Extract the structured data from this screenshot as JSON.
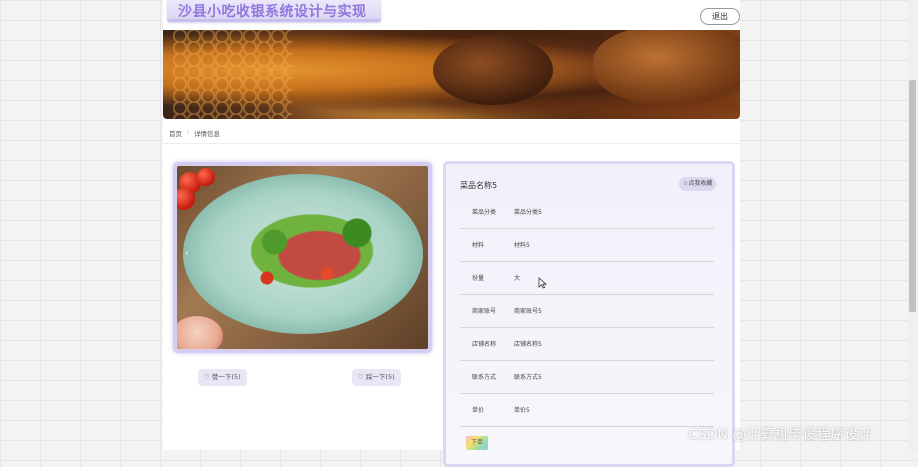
{
  "header": {
    "site_title": "沙县小吃收银系统设计与实现",
    "logout_label": "退出"
  },
  "breadcrumb": {
    "home": "首页",
    "separator": ":",
    "current": "详情信息"
  },
  "gallery": {
    "prev_glyph": "‹",
    "dots": 3,
    "active_dot": 0,
    "like_label": "赞一下(5)",
    "dislike_label": "踩一下(5)"
  },
  "detail": {
    "title": "菜品名称5",
    "favorite_label": "点我收藏",
    "rows": [
      {
        "label": "菜品分类",
        "value": "菜品分类5"
      },
      {
        "label": "材料",
        "value": "材料5"
      },
      {
        "label": "份量",
        "value": "大"
      },
      {
        "label": "商家账号",
        "value": "商家账号5"
      },
      {
        "label": "店铺名称",
        "value": "店铺名称5"
      },
      {
        "label": "联系方式",
        "value": "联系方式5"
      },
      {
        "label": "单价",
        "value": "单价5"
      }
    ],
    "tag_label": "下单"
  },
  "watermark": "CSDN @计算机毕设程序设计",
  "colors": {
    "accent": "#8f77dd",
    "card_border": "#dcd6f2",
    "pill_bg": "#e9e6f6"
  }
}
